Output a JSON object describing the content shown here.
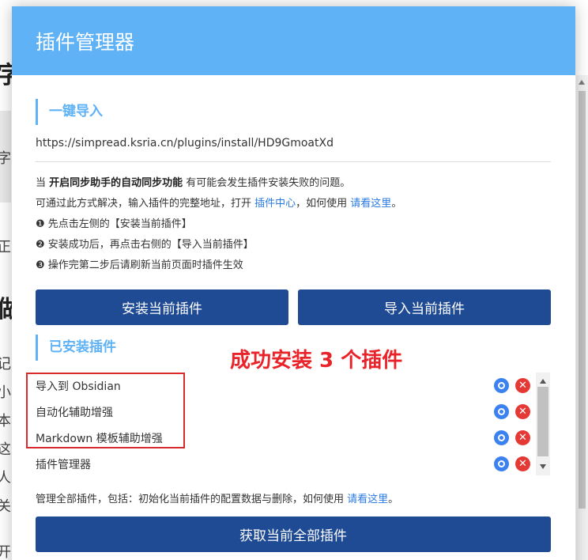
{
  "background": {
    "fragments": [
      "字",
      "字",
      "正",
      "做",
      "记",
      "小",
      "本",
      "这",
      "人",
      "关",
      "开"
    ]
  },
  "dialog": {
    "title": "插件管理器",
    "import_section": {
      "heading": "一键导入",
      "url": "https://simpread.ksria.cn/plugins/install/HD9GmoatXd",
      "note_prefix": "当 ",
      "note_bold": "开启同步助手的自动同步功能",
      "note_suffix": " 有可能会发生插件安装失败的问题。",
      "solution_prefix": "可通过此方式解决，输入插件的完整地址，打开 ",
      "solution_link1": "插件中心",
      "solution_mid": "，如何使用 ",
      "solution_link2": "请看这里",
      "solution_end": "。",
      "step1": "❶ 先点击左侧的【安装当前插件】",
      "step2": "❷ 安装成功后，再点击右侧的【导入当前插件】",
      "step3": "❸ 操作完第二步后请刷新当前页面时插件生效",
      "install_button": "安装当前插件",
      "import_button": "导入当前插件"
    },
    "installed_section": {
      "heading": "已安装插件",
      "success_message": "成功安装 3 个插件",
      "plugins": [
        {
          "name": "导入到 Obsidian"
        },
        {
          "name": "自动化辅助增强"
        },
        {
          "name": "Markdown 模板辅助增强"
        },
        {
          "name": "插件管理器"
        }
      ],
      "manage_prefix": "管理全部插件，包括：初始化当前插件的配置数据与删除，如何使用 ",
      "manage_link": "请看这里",
      "manage_end": "。",
      "fetch_button": "获取当前全部插件"
    }
  },
  "colors": {
    "header": "#5fb2f5",
    "button": "#1f4a94",
    "link": "#2a7ae2",
    "success": "#e8232a",
    "settings_icon": "#3b82f0",
    "delete_icon": "#e53935"
  }
}
